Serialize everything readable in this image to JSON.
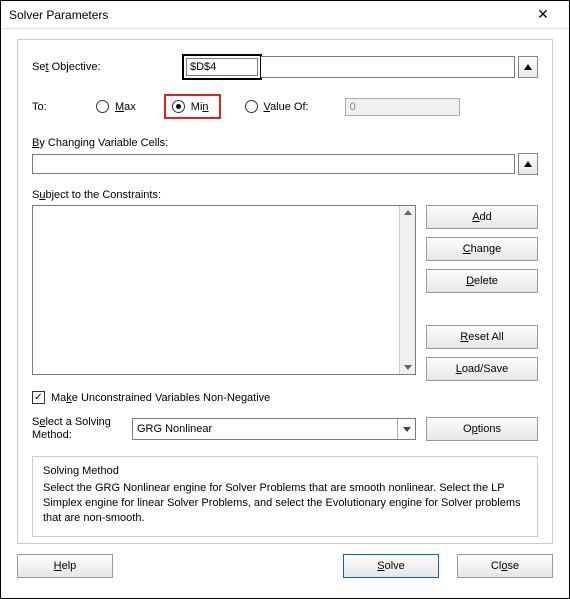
{
  "window": {
    "title": "Solver Parameters"
  },
  "objective": {
    "label": "Set Objective:",
    "label_u": "t",
    "value": "$D$4"
  },
  "to": {
    "label": "To:",
    "max": "Max",
    "max_u": "M",
    "min": "Min",
    "min_u": "M",
    "valueof": "Value Of:",
    "valueof_u": "V",
    "value": "0",
    "selected": "min"
  },
  "changing": {
    "label": "By Changing Variable Cells:",
    "label_u": "B"
  },
  "constraints": {
    "label": "Subject to the Constraints:",
    "label_u": "u",
    "add": "Add",
    "add_u": "A",
    "change": "Change",
    "change_u": "C",
    "delete": "Delete",
    "delete_u": "D",
    "resetall": "Reset All",
    "resetall_u": "R",
    "loadsave": "Load/Save",
    "loadsave_u": "L"
  },
  "checkbox": {
    "label": "Make Unconstrained Variables Non-Negative",
    "label_u": "K",
    "checked": true
  },
  "method": {
    "label": "Select a Solving Method:",
    "label_u": "E",
    "selected": "GRG Nonlinear",
    "options": "Options",
    "options_u": "p"
  },
  "desc": {
    "title": "Solving Method",
    "text": "Select the GRG Nonlinear engine for Solver Problems that are smooth nonlinear. Select the LP Simplex engine for linear Solver Problems, and select the Evolutionary engine for Solver problems that are non-smooth."
  },
  "buttons": {
    "help": "Help",
    "help_u": "H",
    "solve": "Solve",
    "solve_u": "S",
    "close": "Close",
    "close_u": "o"
  }
}
